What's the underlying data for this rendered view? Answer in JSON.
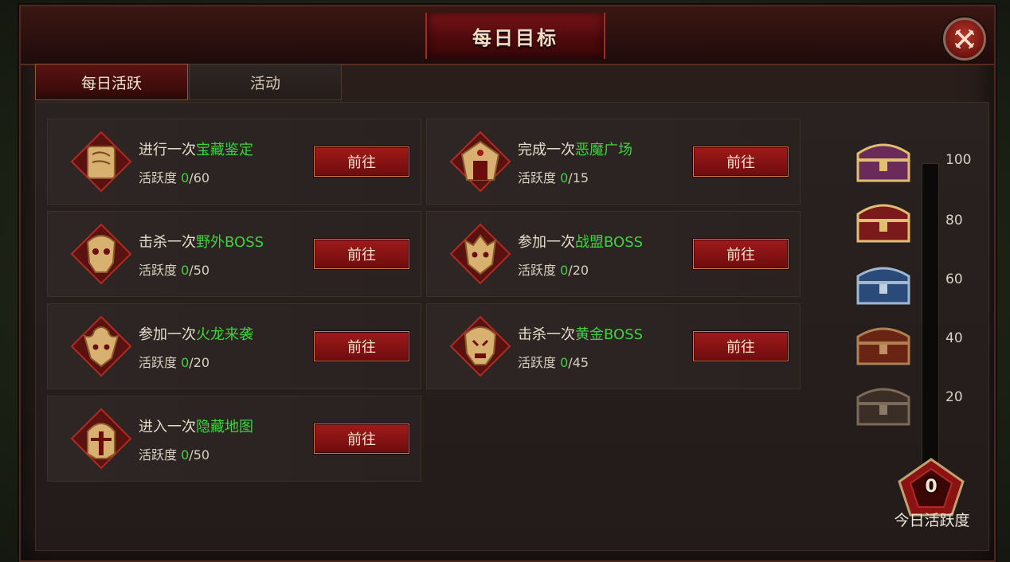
{
  "window": {
    "title": "每日目标"
  },
  "tabs": [
    {
      "label": "每日活跃",
      "active": true
    },
    {
      "label": "活动",
      "active": false
    }
  ],
  "progress_label": "活跃度",
  "go_label": "前往",
  "tasks": [
    {
      "prefix": "进行一次",
      "highlight": "宝藏鉴定",
      "current": "0",
      "max": "/60",
      "icon": "scroll-icon"
    },
    {
      "prefix": "完成一次",
      "highlight": "恶魔广场",
      "current": "0",
      "max": "/15",
      "icon": "demon-gate-icon"
    },
    {
      "prefix": "击杀一次",
      "highlight": "野外BOSS",
      "current": "0",
      "max": "/50",
      "icon": "boss-skull-icon"
    },
    {
      "prefix": "参加一次",
      "highlight": "战盟BOSS",
      "current": "0",
      "max": "/20",
      "icon": "guild-boss-icon"
    },
    {
      "prefix": "参加一次",
      "highlight": "火龙来袭",
      "current": "0",
      "max": "/20",
      "icon": "fire-dragon-icon"
    },
    {
      "prefix": "击杀一次",
      "highlight": "黄金BOSS",
      "current": "0",
      "max": "/45",
      "icon": "golden-boss-icon"
    },
    {
      "prefix": "进入一次",
      "highlight": "隐藏地图",
      "current": "0",
      "max": "/50",
      "icon": "hidden-map-helmet-icon"
    }
  ],
  "rewards": {
    "ticks": [
      "100",
      "80",
      "60",
      "40",
      "20"
    ],
    "chests": [
      "purple-gold-chest-icon",
      "red-gold-chest-icon",
      "blue-chest-icon",
      "red-chest-icon",
      "dark-chest-icon"
    ],
    "today_value": "0",
    "today_label": "今日活跃度",
    "fill_fraction": 0
  },
  "colors": {
    "accent_red": "#8a1414",
    "highlight_green": "#3ed23e",
    "gold": "#d8b070"
  }
}
